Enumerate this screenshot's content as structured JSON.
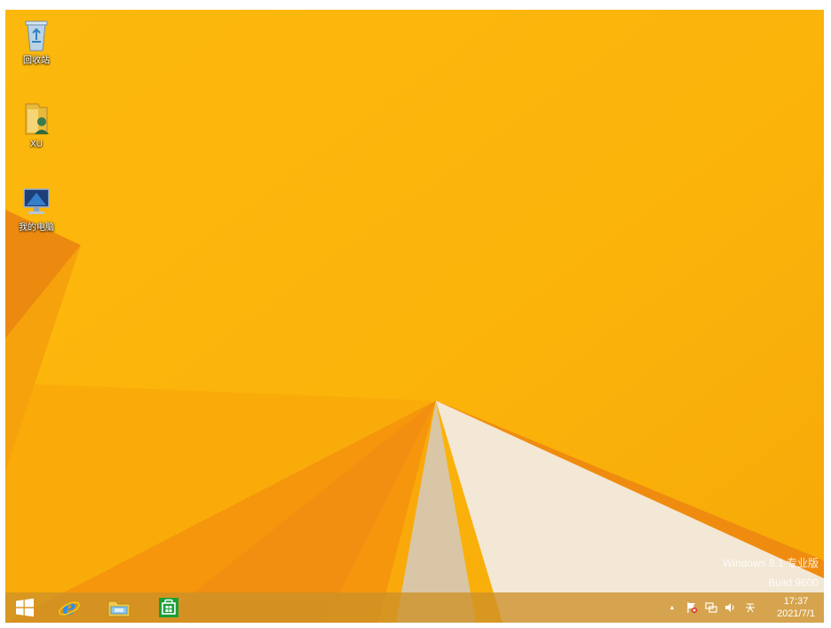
{
  "desktop": {
    "icons": [
      {
        "label": "回收站",
        "icon": "recycle-bin-icon"
      },
      {
        "label": "XU",
        "icon": "user-folder-icon"
      },
      {
        "label": "我的电脑",
        "icon": "computer-icon"
      }
    ]
  },
  "watermark": {
    "line1": "Windows 8.1 专业版",
    "line2": "Build 9600"
  },
  "taskbar": {
    "pinned": [
      {
        "name": "start",
        "icon": "windows-start-icon"
      },
      {
        "name": "internet-explorer",
        "icon": "internet-explorer-icon"
      },
      {
        "name": "file-explorer",
        "icon": "file-explorer-icon"
      },
      {
        "name": "store",
        "icon": "store-icon"
      }
    ],
    "tray": {
      "chevron": "▲",
      "time": "17:37",
      "date": "2021/7/1"
    }
  },
  "colors": {
    "wallpaper": "#fbb40a",
    "taskbar": "#cd9128",
    "store": "#19a03a",
    "ie": "#2d8fe8"
  }
}
